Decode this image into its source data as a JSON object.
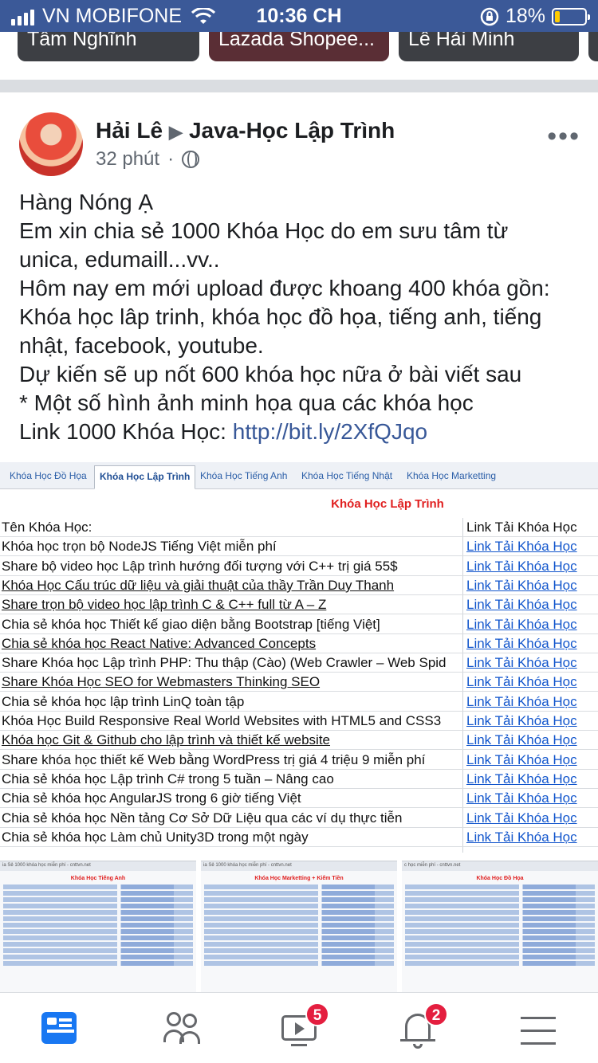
{
  "status_bar": {
    "carrier": "VN MOBIFONE",
    "time": "10:36 CH",
    "battery": "18%",
    "battery_level": 0.18
  },
  "stories": [
    "Tâm Nghĩnh",
    "Lazada Shopee...",
    "Lê Hải Minh"
  ],
  "post": {
    "author": "Hải Lê",
    "group": "Java-Học Lập Trình",
    "time": "32 phút",
    "more": "•••",
    "lines": [
      "Hàng Nóng Ạ",
      "Em xin chia sẻ 1000 Khóa Học do em sưu tâm từ",
      "unica, edumaill...vv..",
      "Hôm nay em mới upload được khoang 400 khóa gồn:",
      "Khóa học lâp trinh, khóa học đồ họa, tiếng anh, tiếng",
      "nhật, facebook, youtube.",
      "Dự kiến sẽ up nốt 600 khóa học nữa ở bài viết sau",
      "* Một số hình ảnh minh họa qua các khóa học"
    ],
    "link_prefix": "Link 1000 Khóa Học: ",
    "link": "http://bit.ly/2XfQJqo"
  },
  "sheet": {
    "tabs": [
      "Khóa Học Đồ Họa",
      "Khóa Học Lập Trình",
      "Khóa Học Tiếng Anh",
      "Khóa Học Tiếng Nhật",
      "Khóa Học Marketting"
    ],
    "active_tab": "Khóa Học Lập Trình",
    "title": "Khóa Học Lập Trình",
    "header": [
      "Tên Khóa Học:",
      "Link Tải Khóa Học"
    ],
    "link_label": "Link Tải Khóa Học",
    "rows": [
      "Khóa học trọn bộ NodeJS Tiếng Việt miễn phí",
      "Share bộ video học Lập trình hướng đối tượng với C++ trị giá 55$",
      "Khóa Học Cấu trúc dữ liệu và giải thuật của thầy Trần Duy Thanh",
      "Share trọn bộ video học lập trình C & C++ full từ A – Z",
      "Chia sẻ khóa học Thiết kế giao diện bằng Bootstrap [tiếng Việt]",
      "Chia sẻ khóa học React Native: Advanced Concepts",
      "Share Khóa học Lập trình PHP: Thu thập (Cào) (Web Crawler – Web Spid",
      "Share Khóa Học SEO for Webmasters Thinking SEO",
      "Chia sẻ khóa học lập trình LinQ toàn tập",
      "Khóa Học Build Responsive Real World Websites with HTML5 and CSS3",
      "Khóa học Git & Github cho lập trình và thiết kế website",
      "Share khóa học thiết kế Web bằng WordPress trị giá 4 triệu 9 miễn phí",
      "Chia sẻ khóa học Lập trình C# trong 5 tuần – Nâng cao",
      "Chia sẻ khóa học AngularJS trong 6 giờ tiếng Việt",
      "Chia sẻ khóa học Nền tảng Cơ Sở Dữ Liệu qua các ví dụ thực tiễn",
      "Chia sẻ khóa học Làm chủ Unity3D trong một ngày"
    ],
    "underlined": [
      2,
      3,
      5,
      7,
      10
    ],
    "thumbs": [
      {
        "bar": "ia Sẻ 1000 khóa học miễn phí - cnttvn.net",
        "title": "Khóa Học Tiếng Anh"
      },
      {
        "bar": "ia Sẻ 1000 khóa học miễn phí - cnttvn.net",
        "title": "Khóa Học Marketting + Kiếm Tiền"
      },
      {
        "bar": "c học miễn phí - cnttvn.net",
        "title": "Khóa Học Đồ Họa"
      }
    ]
  },
  "bottom_nav": {
    "watch_badge": "5",
    "notif_badge": "2"
  }
}
